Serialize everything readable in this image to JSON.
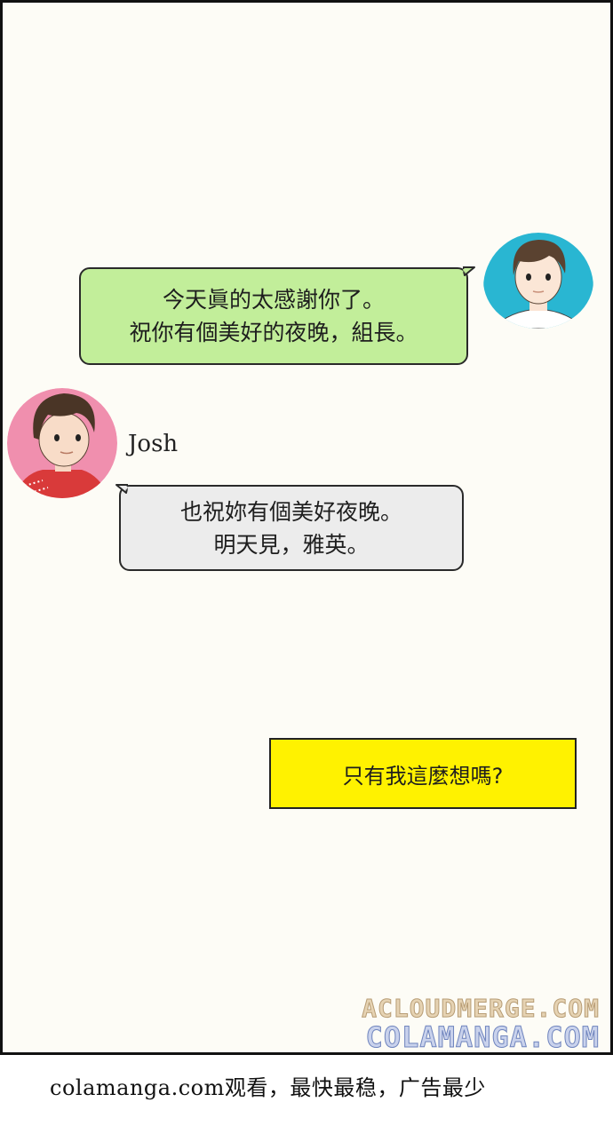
{
  "panel": {
    "bubble_right": {
      "lines": [
        "今天眞的太感謝你了。",
        "祝你有個美好的夜晚，組長。"
      ]
    },
    "speaker_name": "Josh",
    "bubble_left": {
      "lines": [
        "也祝妳有個美好夜晚。",
        "明天見，雅英。"
      ]
    },
    "narration_box": "只有我這麼想嗎?",
    "watermark_top": "ACLOUDMERGE.COM",
    "watermark_bottom": "COLAMANGA.COM"
  },
  "footer": {
    "text": "colamanga.com观看，最快最稳，广告最少"
  },
  "colors": {
    "green_bubble": "#c2ee9a",
    "gray_bubble": "#ececec",
    "yellow_box": "#fff200",
    "avatar_blue": "#29b6d2",
    "avatar_pink": "#f08fae"
  }
}
